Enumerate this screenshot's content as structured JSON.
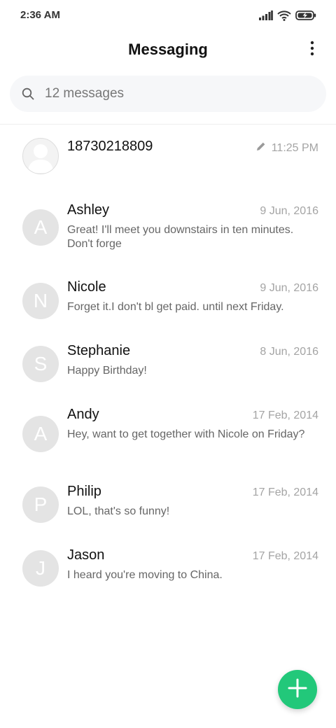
{
  "status_bar": {
    "time": "2:36 AM",
    "icons": [
      "signal-icon",
      "wifi-icon",
      "battery-charging-icon"
    ]
  },
  "header": {
    "title": "Messaging",
    "more_icon": "more-vertical-icon"
  },
  "search": {
    "placeholder": "12 messages",
    "icon": "search-icon"
  },
  "conversations": [
    {
      "name": "18730218809",
      "date": "11:25 PM",
      "preview": "",
      "avatar": "contact-placeholder",
      "draft": true
    },
    {
      "name": "Ashley",
      "date": "9 Jun, 2016",
      "preview": "Great! I'll meet you downstairs in ten minutes. Don't forge",
      "avatar": "A"
    },
    {
      "name": "Nicole",
      "date": "9 Jun, 2016",
      "preview": "Forget it.I don't bl get paid. until next Friday.",
      "avatar": "N"
    },
    {
      "name": "Stephanie",
      "date": "8 Jun, 2016",
      "preview": "Happy Birthday!",
      "avatar": "S"
    },
    {
      "name": "Andy",
      "date": "17 Feb, 2014",
      "preview": "Hey, want to get together with Nicole on Friday?",
      "avatar": "A"
    },
    {
      "name": "Philip",
      "date": "17 Feb, 2014",
      "preview": "LOL, that's so funny!",
      "avatar": "P"
    },
    {
      "name": "Jason",
      "date": "17 Feb, 2014",
      "preview": "I heard you're moving to China.",
      "avatar": "J"
    }
  ],
  "fab": {
    "icon": "plus-icon",
    "color": "#22c87a"
  },
  "colors": {
    "accent": "#22c87a",
    "avatar_bg": "#e4e4e4",
    "date_text": "#a4a4a4",
    "preview_text": "#666666"
  }
}
